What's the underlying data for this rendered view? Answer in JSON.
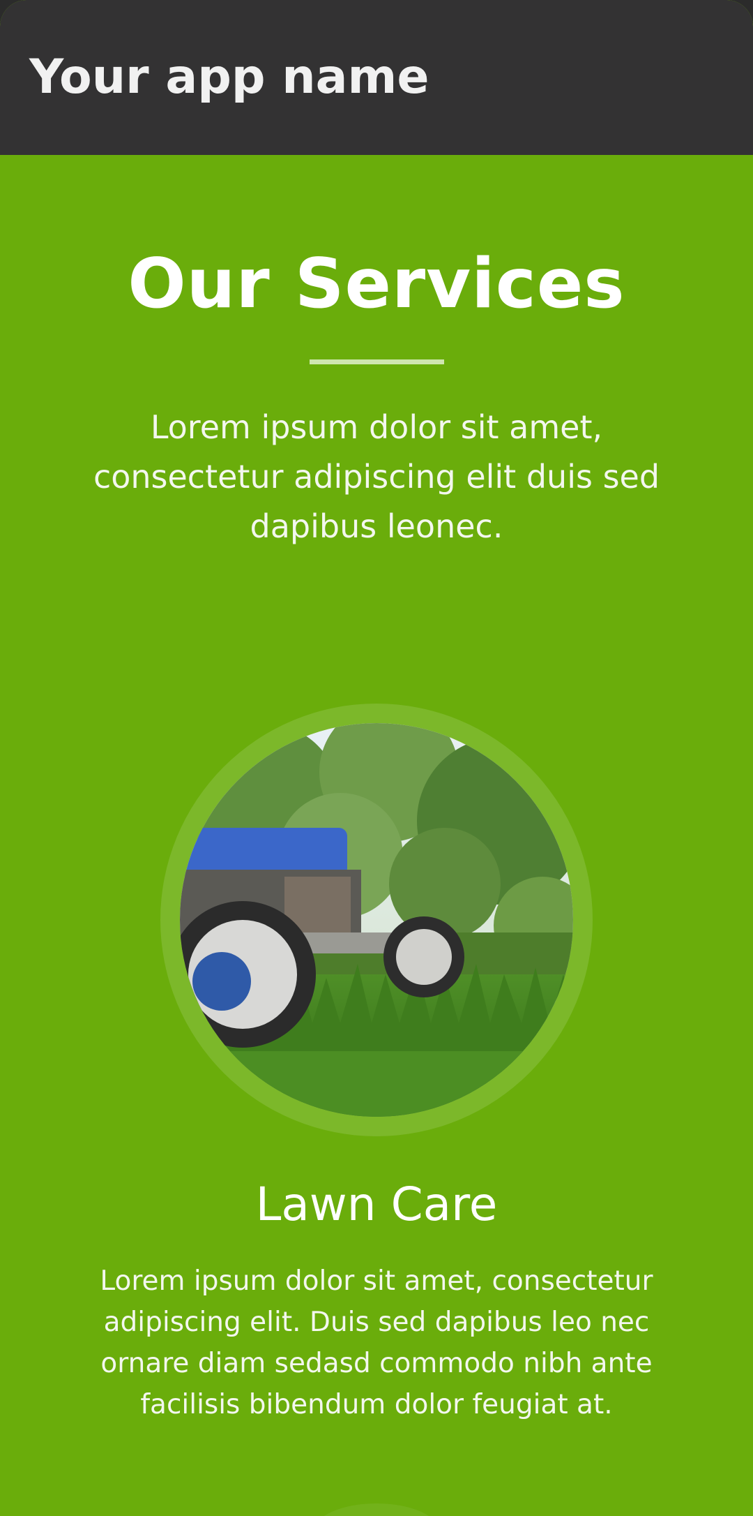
{
  "app_bar": {
    "title": "Your app name"
  },
  "services_section": {
    "title": "Our Services",
    "intro": "Lorem ipsum dolor sit amet, consectetur adipiscing elit duis sed dapibus leonec."
  },
  "services": [
    {
      "image_subject": "lawn-mower-on-grass",
      "title": "Lawn Care",
      "description": "Lorem ipsum dolor sit amet, consectetur adipiscing elit. Duis sed dapibus leo nec ornare diam sedasd commodo nibh ante facilisis bibendum dolor feugiat at."
    }
  ],
  "colors": {
    "app_bar_bg": "#333233",
    "page_bg": "#6aad0b",
    "ring": "#7cb82a",
    "text": "#ffffff"
  }
}
